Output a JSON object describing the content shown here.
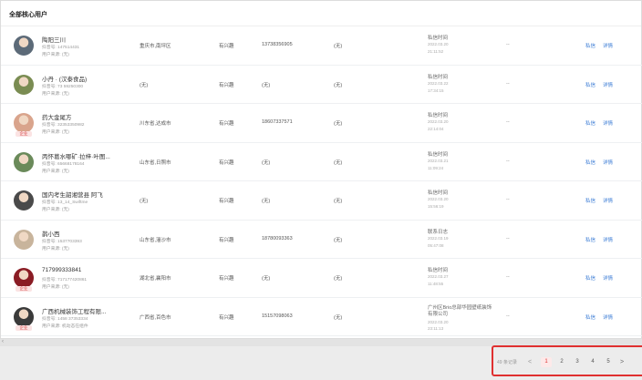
{
  "header": {
    "title": "全部核心用户"
  },
  "rows": [
    {
      "name": "陶阳三川",
      "id": "抖音号: 147514431",
      "source": "用户来源: (无)",
      "location": "重庆市,南坪区",
      "type": "有兴趣",
      "phone": "13738356905",
      "remark": "(无)",
      "time_label": "私信时间",
      "time_date": "2022.03.20",
      "time_clock": "21:11:52",
      "dash": "--",
      "chat": "私信",
      "detail": "详情",
      "avatar_color": "#5c6a78",
      "tag": ""
    },
    {
      "name": "小丹 · (汉泰食品)",
      "id": "抖音号: 73 59250300",
      "source": "用户来源: (无)",
      "location": "(无)",
      "type": "有兴趣",
      "phone": "(无)",
      "remark": "(无)",
      "time_label": "私信时间",
      "time_date": "2022.03.22",
      "time_clock": "17:34:15",
      "dash": "--",
      "chat": "私信",
      "detail": "详情",
      "avatar_color": "#7a8c52",
      "tag": ""
    },
    {
      "name": "药大金尾方",
      "id": "抖音号: 32353350982",
      "source": "用户来源: (无)",
      "location": "川东省,达成市",
      "type": "有兴趣",
      "phone": "18607337571",
      "remark": "(无)",
      "time_label": "私信时间",
      "time_date": "2022.03.20",
      "time_clock": "22:14:04",
      "dash": "--",
      "chat": "私信",
      "detail": "详情",
      "avatar_color": "#d9a48c",
      "tag": "企业"
    },
    {
      "name": "丙怀葛水哪矿·拉梓·叶图...",
      "id": "抖音号: 65668178164",
      "source": "用户来源: (无)",
      "location": "山东省,日照市",
      "type": "有兴趣",
      "phone": "(无)",
      "remark": "(无)",
      "time_label": "私信时间",
      "time_date": "2022.03.21",
      "time_clock": "11:09:24",
      "dash": "--",
      "chat": "私信",
      "detail": "详情",
      "avatar_color": "#6a8a5a",
      "tag": ""
    },
    {
      "name": "国内考生韶湘营县 阿飞",
      "id": "抖音号: 13_14_Swiftme",
      "source": "用户来源: (无)",
      "location": "(无)",
      "type": "有兴趣",
      "phone": "(无)",
      "remark": "(无)",
      "time_label": "私信时间",
      "time_date": "2022.03.20",
      "time_clock": "15:56:19",
      "dash": "--",
      "chat": "私信",
      "detail": "详情",
      "avatar_color": "#4a4a4a",
      "tag": ""
    },
    {
      "name": "鹊小西",
      "id": "抖音号: 1537703393",
      "source": "用户来源: (无)",
      "location": "山东省,淄沙市",
      "type": "有兴趣",
      "phone": "18780093363",
      "remark": "(无)",
      "time_label": "联系日志",
      "time_date": "2022.03.19",
      "time_clock": "05:47:08",
      "dash": "--",
      "chat": "私信",
      "detail": "详情",
      "avatar_color": "#c8b49c",
      "tag": ""
    },
    {
      "name": "717999333841",
      "id": "抖音号: 717177420861",
      "source": "用户来源: (无)",
      "location": "湖北省,襄阳市",
      "type": "有兴趣",
      "phone": "(无)",
      "remark": "(无)",
      "time_label": "私信时间",
      "time_date": "2022.03.27",
      "time_clock": "11:48:55",
      "dash": "--",
      "chat": "私信",
      "detail": "详情",
      "avatar_color": "#8a1c24",
      "tag": "企业"
    },
    {
      "name": "广西机械装饰工程有限...",
      "id": "抖音号: 1458 37353334",
      "source": "用户来源: 机动态在组件",
      "location": "广西省,百色市",
      "type": "有兴趣",
      "phone": "15157098063",
      "remark": "(无)",
      "time_label": "广州区Brio总部华园壁纸装饰有限公司",
      "time_date": "2022.03.20",
      "time_clock": "23:11:13",
      "dash": "--",
      "chat": "私信",
      "detail": "详情",
      "avatar_color": "#3a3a3a",
      "tag": "企业"
    }
  ],
  "pagination": {
    "total": "49 条记录",
    "prev": "<",
    "pages": [
      "1",
      "2",
      "3",
      "4",
      "5"
    ],
    "active": "1",
    "next": ">"
  }
}
